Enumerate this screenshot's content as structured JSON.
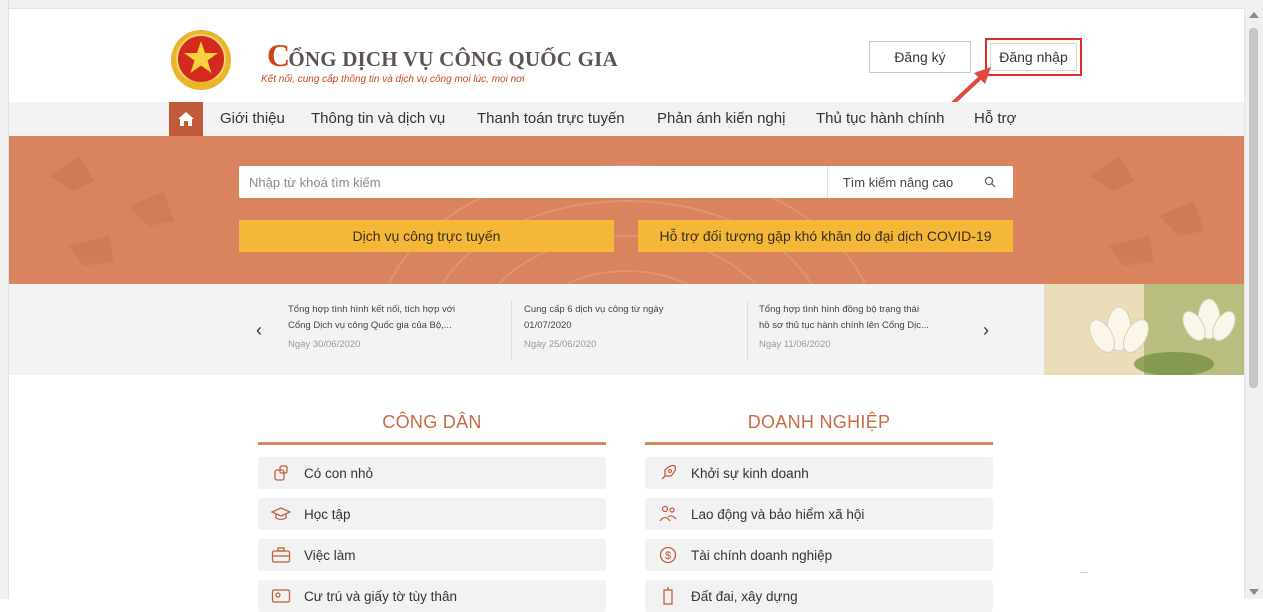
{
  "header": {
    "title_rest": "ỔNG DỊCH VỤ CÔNG QUỐC GIA",
    "title_first": "C",
    "subtitle": "Kết nối, cung cấp thông tin và dịch vụ công mọi lúc, mọi nơi",
    "register_label": "Đăng ký",
    "login_label": "Đăng nhập"
  },
  "nav": {
    "items": [
      "Giới thiệu",
      "Thông tin và dịch vụ",
      "Thanh toán trực tuyến",
      "Phản ánh kiến nghị",
      "Thủ tục hành chính",
      "Hỗ trợ"
    ]
  },
  "search": {
    "placeholder": "Nhập từ khoá tìm kiếm",
    "advanced_label": "Tìm kiếm nâng cao"
  },
  "banner_buttons": {
    "online_services": "Dịch vụ công trực tuyến",
    "covid_support": "Hỗ trợ đối tượng gặp khó khăn do đại dịch COVID-19"
  },
  "news": {
    "prev_label": "‹",
    "next_label": "›",
    "items": [
      {
        "title_line1": "Tổng hợp tình hình kết nối, tích hợp với",
        "title_line2": "Cổng Dịch vụ công Quốc gia của Bộ,...",
        "date": "Ngày 30/06/2020"
      },
      {
        "title_line1": "Cung cấp 6 dịch vụ công từ ngày",
        "title_line2": "01/07/2020",
        "date": "Ngày 25/06/2020"
      },
      {
        "title_line1": "Tổng hợp tình hình đồng bộ trạng thái",
        "title_line2": "hồ sơ thủ tục hành chính lên Cổng Dịc...",
        "date": "Ngày 11/06/2020"
      }
    ]
  },
  "citizen": {
    "title": "CÔNG DÂN",
    "items": [
      "Có con nhỏ",
      "Học tập",
      "Việc làm",
      "Cư trú và giấy tờ tùy thân"
    ]
  },
  "business": {
    "title": "DOANH NGHIỆP",
    "items": [
      "Khởi sự kinh doanh",
      "Lao động và bảo hiểm xã hội",
      "Tài chính doanh nghiệp",
      "Đất đai, xây dựng"
    ]
  },
  "colors": {
    "brand": "#c8451e",
    "banner": "#d9835f",
    "nav_home": "#c05a3a",
    "yellow_button": "#f4b738",
    "highlight_box": "#e02b2b",
    "section_title": "#c86b45"
  },
  "icons": {
    "home": "home-icon",
    "search": "search-icon",
    "arrow": "red-arrow-icon"
  }
}
